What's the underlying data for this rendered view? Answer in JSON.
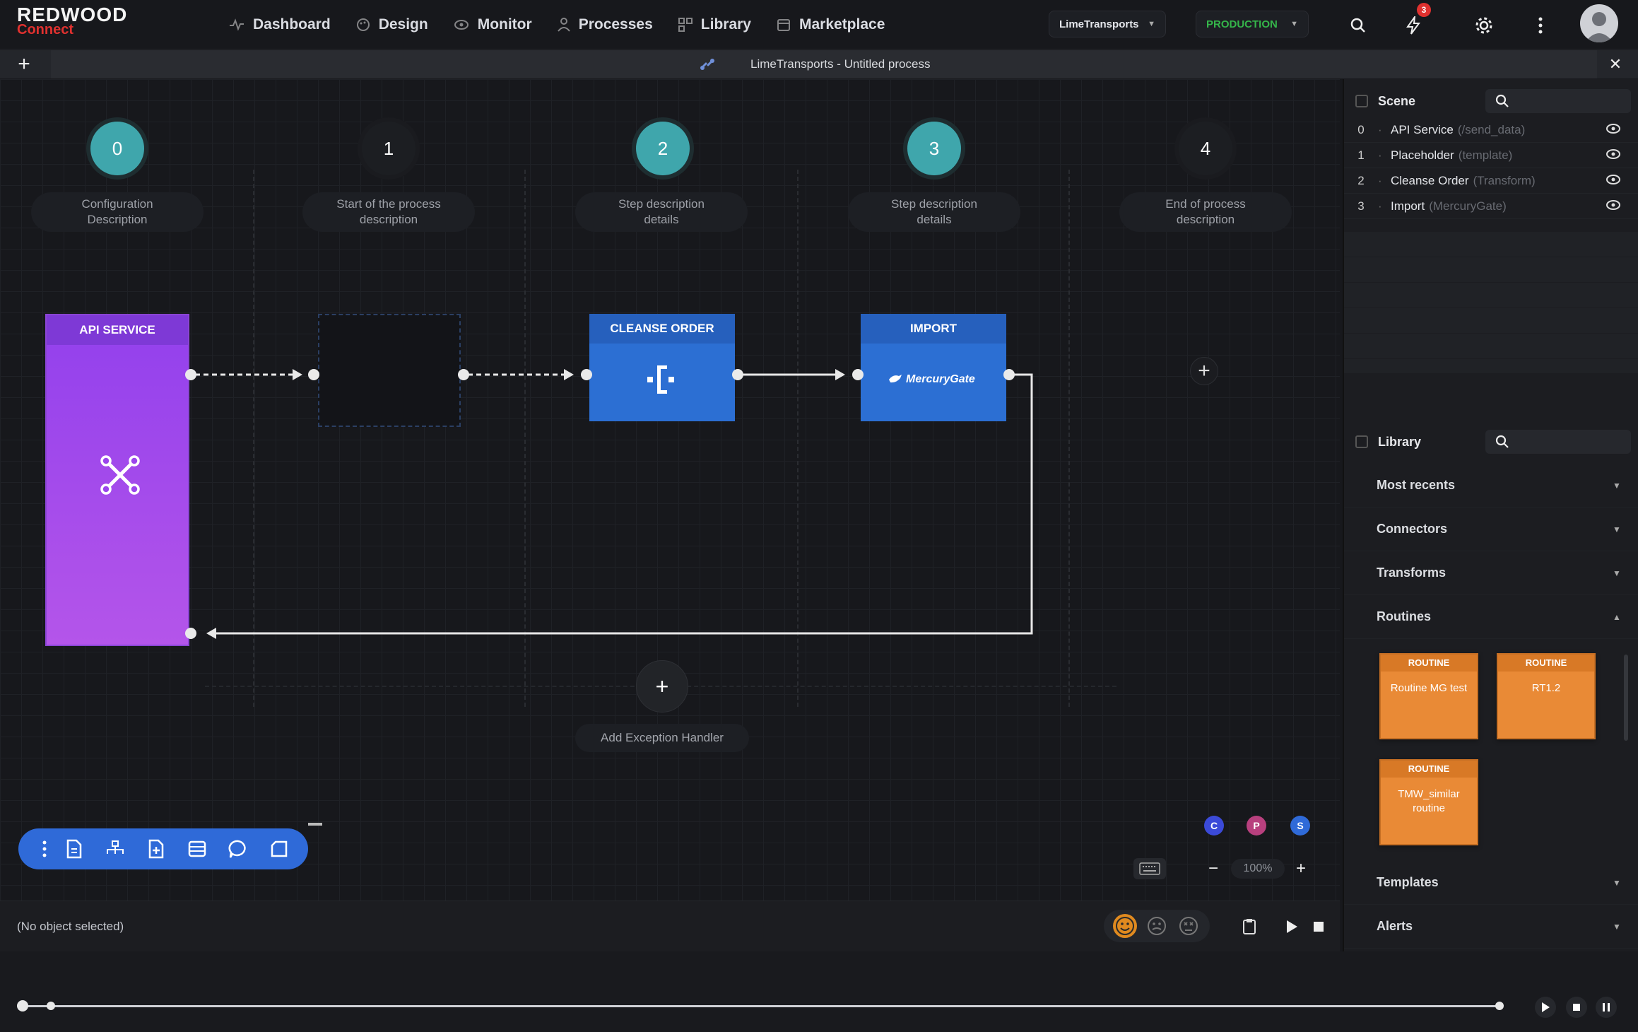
{
  "brand": {
    "name": "REDWOOD",
    "product": "Connect"
  },
  "nav": [
    {
      "label": "Dashboard",
      "icon": "pulse-icon"
    },
    {
      "label": "Design",
      "icon": "palette-icon"
    },
    {
      "label": "Monitor",
      "icon": "eye-icon"
    },
    {
      "label": "Processes",
      "icon": "person-icon"
    },
    {
      "label": "Library",
      "icon": "library-icon"
    },
    {
      "label": "Marketplace",
      "icon": "store-icon"
    }
  ],
  "tenant": {
    "label": "LimeTransports"
  },
  "environment": {
    "label": "PRODUCTION",
    "color": "#35b54a"
  },
  "notifications": {
    "count": "3"
  },
  "tab": {
    "title": "LimeTransports - Untitled process"
  },
  "stages": [
    {
      "number": "0",
      "label": "Configuration\nDescription",
      "active": true
    },
    {
      "number": "1",
      "label": "Start of the process\ndescription",
      "active": false
    },
    {
      "number": "2",
      "label": "Step description\ndetails",
      "active": true
    },
    {
      "number": "3",
      "label": "Step description\ndetails",
      "active": true
    },
    {
      "number": "4",
      "label": "End of process\ndescription",
      "active": false
    }
  ],
  "blocks": {
    "api_service": {
      "title": "API SERVICE",
      "color": "#9b45ec"
    },
    "cleanse_order": {
      "title": "CLEANSE ORDER",
      "color": "#2c6fd3"
    },
    "import": {
      "title": "IMPORT",
      "logo": "MercuryGate",
      "color": "#2c6fd3"
    }
  },
  "exception": {
    "label": "Add Exception Handler"
  },
  "collaborators": [
    {
      "initial": "C",
      "color": "#3b4ad8"
    },
    {
      "initial": "P",
      "color": "#b8407e"
    },
    {
      "initial": "S",
      "color": "#2f6ad8"
    }
  ],
  "zoom": {
    "level": "100%"
  },
  "status": {
    "text": "(No object selected)"
  },
  "scene": {
    "title": "Scene",
    "items": [
      {
        "index": "0",
        "name": "API Service",
        "sub": "(/send_data)"
      },
      {
        "index": "1",
        "name": "Placeholder",
        "sub": "(template)"
      },
      {
        "index": "2",
        "name": "Cleanse Order",
        "sub": "(Transform)"
      },
      {
        "index": "3",
        "name": "Import",
        "sub": "(MercuryGate)"
      }
    ]
  },
  "library": {
    "title": "Library",
    "categories_top": [
      {
        "label": "Most recents"
      },
      {
        "label": "Connectors"
      },
      {
        "label": "Transforms"
      },
      {
        "label": "Routines"
      }
    ],
    "routines": [
      {
        "header": "ROUTINE",
        "name": "Routine MG test"
      },
      {
        "header": "ROUTINE",
        "name": "RT1.2"
      },
      {
        "header": "ROUTINE",
        "name": "TMW_similar routine"
      }
    ],
    "categories_bottom": [
      {
        "label": "Templates"
      },
      {
        "label": "Alerts"
      }
    ]
  },
  "colors": {
    "accent": "#2f6ad8",
    "stage_active": "#3fa6ac",
    "routine": "#e98a36",
    "brand_red": "#e0312f"
  }
}
